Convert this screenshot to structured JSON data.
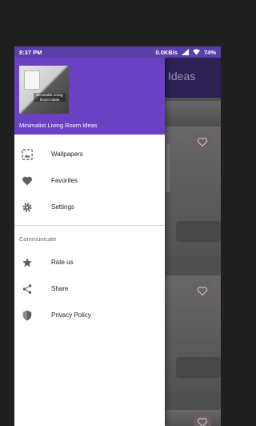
{
  "status_bar": {
    "time": "8:37 PM",
    "speed": "0.0KB/s",
    "battery": "74%"
  },
  "background_app": {
    "title_fragment": "Ideas"
  },
  "drawer": {
    "thumbnail_caption": "Minimalist Living Room Ideas",
    "app_title": "Minimalist Living Room Ideas",
    "items": [
      {
        "label": "Wallpapers",
        "icon": "wallpapers-icon"
      },
      {
        "label": "Favorites",
        "icon": "heart-icon"
      },
      {
        "label": "Settings",
        "icon": "gear-icon"
      }
    ],
    "section_title": "Communicate",
    "communicate_items": [
      {
        "label": "Rate us",
        "icon": "star-icon"
      },
      {
        "label": "Share",
        "icon": "share-icon"
      },
      {
        "label": "Privacy Policy",
        "icon": "shield-icon"
      }
    ]
  },
  "colors": {
    "primary": "#6b41c4",
    "status_bar": "#5a3fa8",
    "icon": "#5f5f5f"
  }
}
